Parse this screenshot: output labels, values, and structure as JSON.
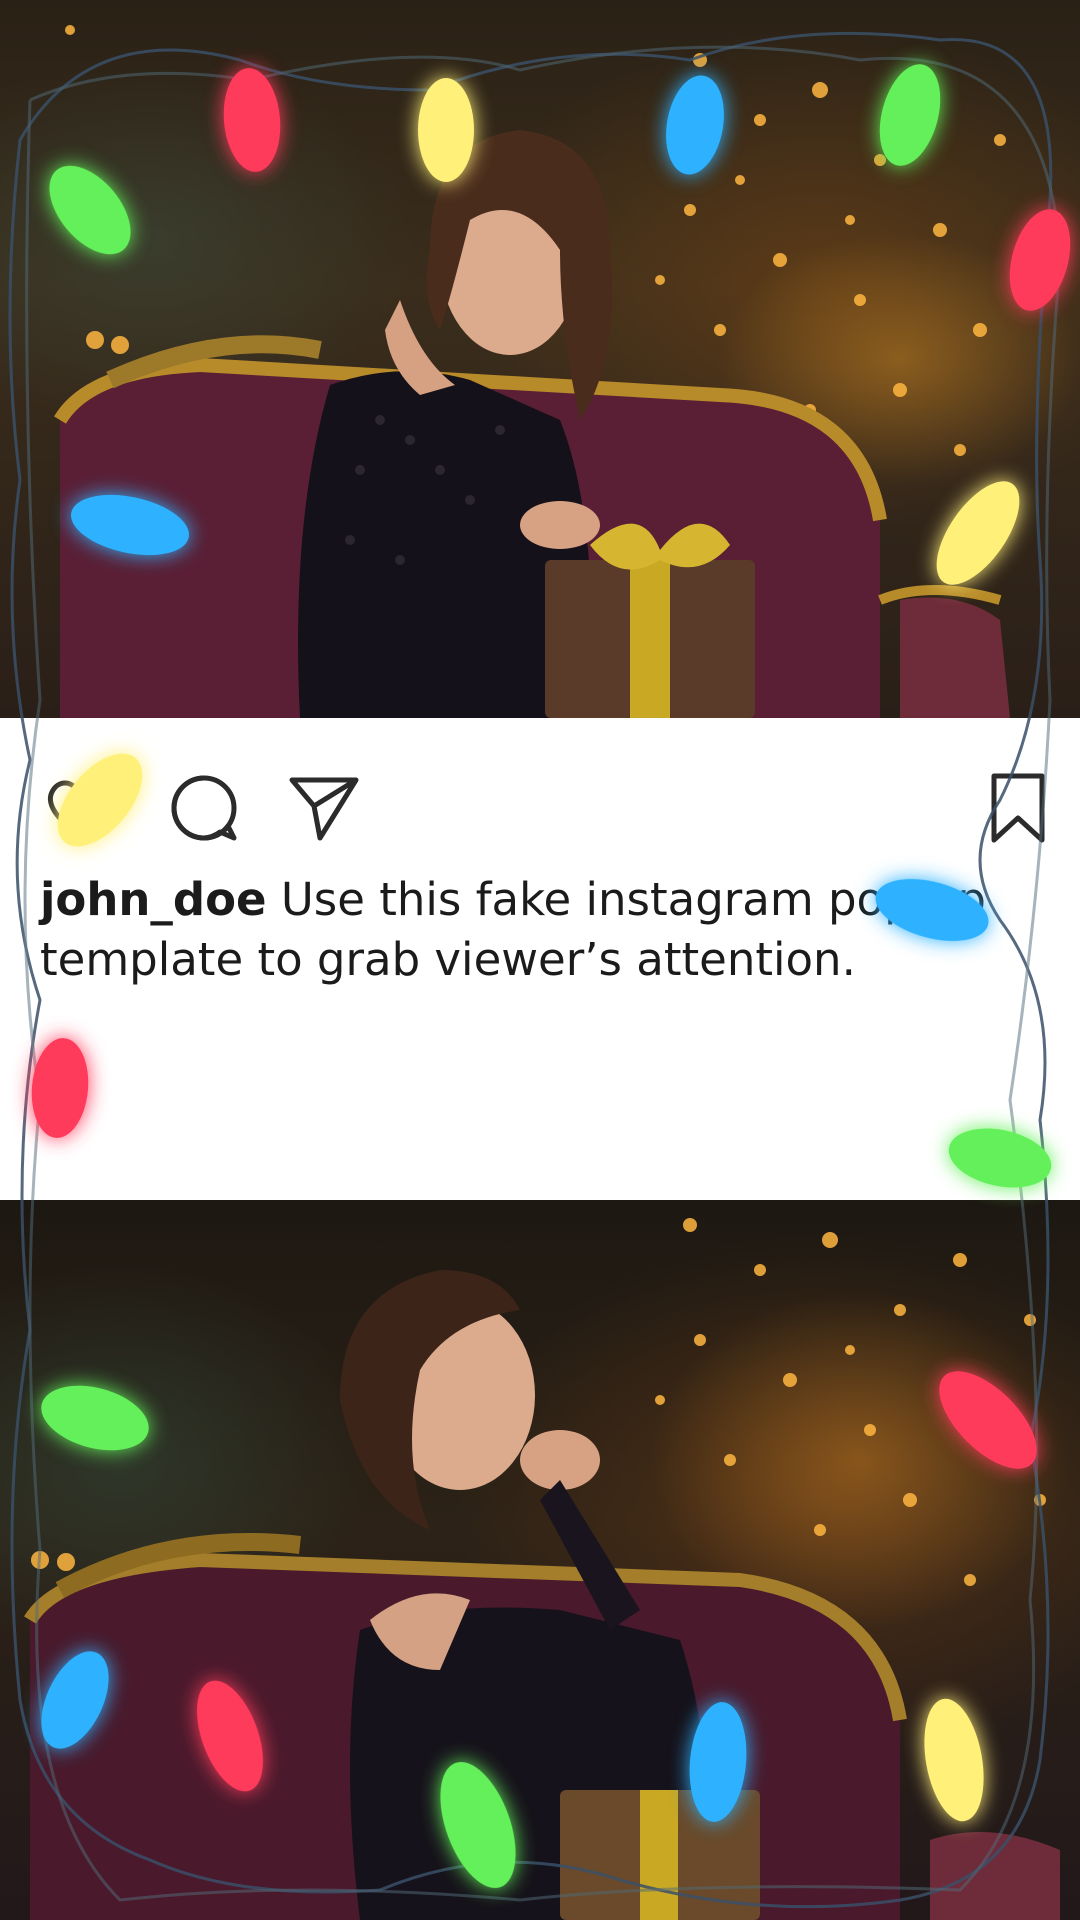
{
  "post": {
    "username": "john_doe",
    "caption_text": "Use this fake instagram pop-up template to grab viewer’s attention."
  },
  "actions": {
    "like_icon": "heart-icon",
    "comment_icon": "comment-icon",
    "share_icon": "send-icon",
    "save_icon": "bookmark-icon"
  },
  "images": {
    "top_photo": "woman-opening-gift-photo",
    "bottom_photo": "woman-smiling-photo"
  },
  "colors": {
    "card_background": "#ffffff",
    "text": "#1b1b1b",
    "icon_stroke": "#2b2b2b",
    "bulb_red": "#ff3b5c",
    "bulb_yellow": "#fff07a",
    "bulb_blue": "#2fb2ff",
    "bulb_green": "#64f05a"
  }
}
